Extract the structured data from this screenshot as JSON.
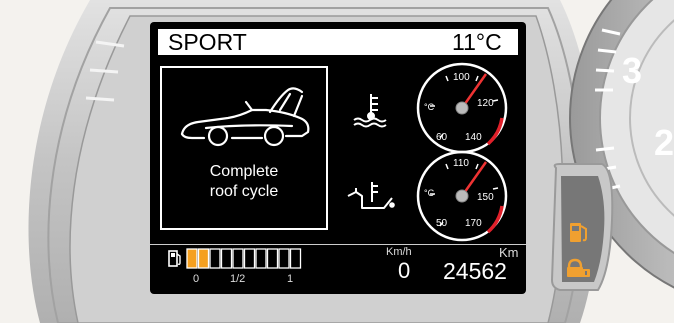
{
  "display": {
    "drive_mode": "SPORT",
    "outside_temperature": "11°C",
    "message_line1": "Complete",
    "message_line2": "roof cycle"
  },
  "coolant_gauge": {
    "unit": "°C",
    "ticks": [
      "60",
      "100",
      "120",
      "140"
    ]
  },
  "oil_gauge": {
    "unit": "°C",
    "ticks": [
      "50",
      "110",
      "150",
      "170"
    ]
  },
  "fuel": {
    "labels": [
      "0",
      "1/2",
      "1"
    ],
    "filled_segments": 2,
    "total_segments": 10
  },
  "trip": {
    "speed_unit": "Km/h",
    "speed_value": "0",
    "distance_unit": "Km",
    "odometer": "24562"
  },
  "tachometer": {
    "visible_numbers": [
      "3",
      "2"
    ]
  },
  "warning_lights": {
    "icons": [
      "low-fuel-icon",
      "lock-icon"
    ],
    "color": "#f0a030"
  },
  "colors": {
    "redline": "#e0202a",
    "fuel_fill": "#f5a020",
    "display_bg": "#000000"
  }
}
